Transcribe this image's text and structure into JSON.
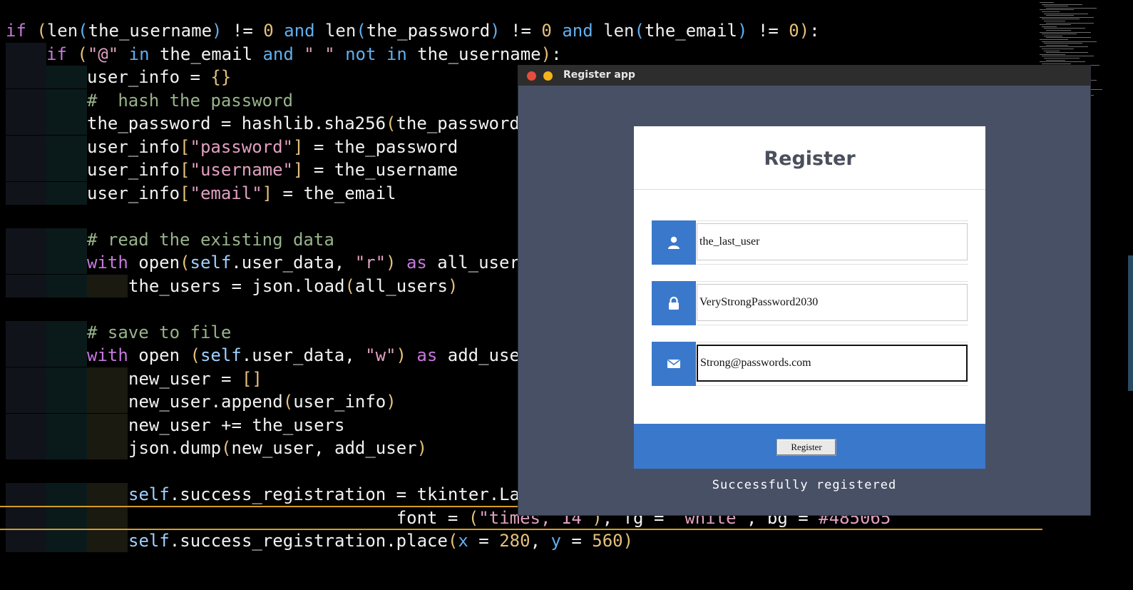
{
  "editor": {
    "lines": [
      {
        "indent": 0,
        "segs": [
          [
            "kw",
            "if "
          ],
          [
            "par",
            "("
          ],
          [
            "bi",
            "len"
          ],
          [
            "kw2",
            "("
          ],
          [
            "",
            "the_username"
          ],
          [
            "kw2",
            ")"
          ],
          [
            "",
            " != "
          ],
          [
            "num",
            "0"
          ],
          [
            "kw2",
            " and "
          ],
          [
            "bi",
            "len"
          ],
          [
            "kw2",
            "("
          ],
          [
            "",
            "the_password"
          ],
          [
            "kw2",
            ")"
          ],
          [
            "",
            " != "
          ],
          [
            "num",
            "0"
          ],
          [
            "kw2",
            " and "
          ],
          [
            "bi",
            "len"
          ],
          [
            "kw2",
            "("
          ],
          [
            "",
            "the_email"
          ],
          [
            "kw2",
            ")"
          ],
          [
            "",
            " != "
          ],
          [
            "num",
            "0"
          ],
          [
            "par",
            ")"
          ],
          [
            "",
            ":"
          ]
        ]
      },
      {
        "indent": 1,
        "segs": [
          [
            "kw",
            "if "
          ],
          [
            "par",
            "("
          ],
          [
            "str",
            "\"@\""
          ],
          [
            "kw2",
            " in "
          ],
          [
            "",
            "the_email"
          ],
          [
            "kw2",
            " and "
          ],
          [
            "str",
            "\" \""
          ],
          [
            "kw2",
            " not in "
          ],
          [
            "",
            "the_username"
          ],
          [
            "par",
            ")"
          ],
          [
            "",
            ":"
          ]
        ]
      },
      {
        "indent": 2,
        "segs": [
          [
            "",
            "user_info = "
          ],
          [
            "par",
            "{}"
          ]
        ]
      },
      {
        "indent": 2,
        "segs": [
          [
            "cm",
            "#  hash the password"
          ]
        ]
      },
      {
        "indent": 2,
        "segs": [
          [
            "",
            "the_password = hashlib.sha256"
          ],
          [
            "par",
            "("
          ],
          [
            "",
            "the_password"
          ]
        ]
      },
      {
        "indent": 2,
        "segs": [
          [
            "",
            "user_info"
          ],
          [
            "par",
            "["
          ],
          [
            "str",
            "\"password\""
          ],
          [
            "par",
            "]"
          ],
          [
            "",
            " = the_password"
          ]
        ]
      },
      {
        "indent": 2,
        "segs": [
          [
            "",
            "user_info"
          ],
          [
            "par",
            "["
          ],
          [
            "str",
            "\"username\""
          ],
          [
            "par",
            "]"
          ],
          [
            "",
            " = the_username"
          ]
        ]
      },
      {
        "indent": 2,
        "segs": [
          [
            "",
            "user_info"
          ],
          [
            "par",
            "["
          ],
          [
            "str",
            "\"email\""
          ],
          [
            "par",
            "]"
          ],
          [
            "",
            " = the_email"
          ]
        ]
      },
      {
        "indent": -1,
        "segs": []
      },
      {
        "indent": 2,
        "segs": [
          [
            "cm",
            "# read the existing data"
          ]
        ]
      },
      {
        "indent": 2,
        "segs": [
          [
            "kw",
            "with "
          ],
          [
            "",
            "open"
          ],
          [
            "par",
            "("
          ],
          [
            "slf",
            "self"
          ],
          [
            "",
            ".user_data, "
          ],
          [
            "str",
            "\"r\""
          ],
          [
            "par",
            ")"
          ],
          [
            "kw",
            " as "
          ],
          [
            "",
            "all_user"
          ]
        ]
      },
      {
        "indent": 3,
        "segs": [
          [
            "",
            "the_users = json.load"
          ],
          [
            "par",
            "("
          ],
          [
            "",
            "all_users"
          ],
          [
            "par",
            ")"
          ]
        ]
      },
      {
        "indent": -1,
        "segs": []
      },
      {
        "indent": 2,
        "segs": [
          [
            "cm",
            "# save to file"
          ]
        ]
      },
      {
        "indent": 2,
        "segs": [
          [
            "kw",
            "with "
          ],
          [
            "",
            "open "
          ],
          [
            "par",
            "("
          ],
          [
            "slf",
            "self"
          ],
          [
            "",
            ".user_data, "
          ],
          [
            "str",
            "\"w\""
          ],
          [
            "par",
            ")"
          ],
          [
            "kw",
            " as "
          ],
          [
            "",
            "add_use"
          ]
        ]
      },
      {
        "indent": 3,
        "segs": [
          [
            "",
            "new_user = "
          ],
          [
            "par",
            "[]"
          ]
        ]
      },
      {
        "indent": 3,
        "segs": [
          [
            "",
            "new_user.append"
          ],
          [
            "par",
            "("
          ],
          [
            "",
            "user_info"
          ],
          [
            "par",
            ")"
          ]
        ]
      },
      {
        "indent": 3,
        "segs": [
          [
            "",
            "new_user += the_users"
          ]
        ]
      },
      {
        "indent": 3,
        "segs": [
          [
            "",
            "json.dump"
          ],
          [
            "par",
            "("
          ],
          [
            "",
            "new_user, add_user"
          ],
          [
            "par",
            ")"
          ]
        ]
      },
      {
        "indent": -1,
        "segs": []
      },
      {
        "indent": 3,
        "segs": [
          [
            "slf",
            "self"
          ],
          [
            "",
            ".success_registration = tkinter.La"
          ]
        ]
      },
      {
        "indent": 3,
        "segs": [
          [
            "",
            "                          "
          ],
          [
            "",
            "font = "
          ],
          [
            "par",
            "("
          ],
          [
            "str",
            "\"times, 14\""
          ],
          [
            "par",
            ")"
          ],
          [
            "",
            ", fg = "
          ],
          [
            "str",
            "\"white\""
          ],
          [
            "",
            ", bg ="
          ],
          [
            "str",
            "\"#485065"
          ]
        ]
      },
      {
        "indent": 3,
        "segs": [
          [
            "slf",
            "self"
          ],
          [
            "",
            ".success_registration.place"
          ],
          [
            "par",
            "("
          ],
          [
            "kw2",
            "x"
          ],
          [
            "",
            " = "
          ],
          [
            "num",
            "280"
          ],
          [
            "",
            ", "
          ],
          [
            "kw2",
            "y"
          ],
          [
            "",
            " = "
          ],
          [
            "num",
            "560"
          ],
          [
            "par",
            ")"
          ]
        ]
      }
    ]
  },
  "window": {
    "title": "Register app",
    "form_title": "Register",
    "username_value": "the_last_user",
    "password_value": "VeryStrongPassword2030",
    "email_value": "Strong@passwords.com",
    "register_label": "Register",
    "status_text": "Successfully registered",
    "bg_color": "#485065",
    "accent_color": "#3a78cc"
  }
}
